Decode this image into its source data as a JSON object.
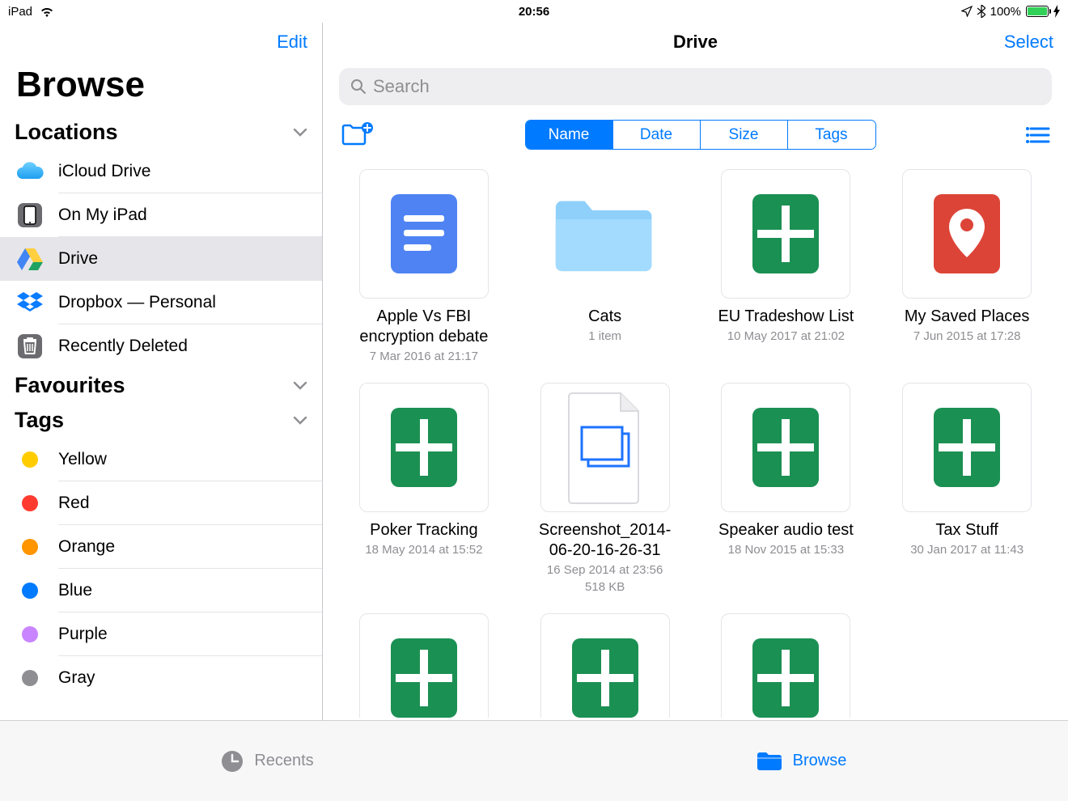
{
  "statusbar": {
    "device": "iPad",
    "time": "20:56",
    "battery_pct": "100%"
  },
  "sidebar": {
    "edit": "Edit",
    "title": "Browse",
    "sections": {
      "locations": "Locations",
      "favourites": "Favourites",
      "tags": "Tags"
    },
    "locations": [
      {
        "label": "iCloud Drive"
      },
      {
        "label": "On My iPad"
      },
      {
        "label": "Drive"
      },
      {
        "label": "Dropbox — Personal"
      },
      {
        "label": "Recently Deleted"
      }
    ],
    "tags": [
      {
        "label": "Yellow",
        "color": "#ffcc00"
      },
      {
        "label": "Red",
        "color": "#ff3b30"
      },
      {
        "label": "Orange",
        "color": "#ff9500"
      },
      {
        "label": "Blue",
        "color": "#007aff"
      },
      {
        "label": "Purple",
        "color": "#c985ff"
      },
      {
        "label": "Gray",
        "color": "#8e8e93"
      }
    ]
  },
  "main": {
    "title": "Drive",
    "select": "Select",
    "search_placeholder": "Search",
    "sort_tabs": [
      "Name",
      "Date",
      "Size",
      "Tags"
    ],
    "files": [
      {
        "name": "Apple Vs FBI encryption debate",
        "meta": "7 Mar 2016 at 21:17",
        "kind": "gdoc"
      },
      {
        "name": "Cats",
        "meta": "1 item",
        "kind": "folder"
      },
      {
        "name": "EU Tradeshow List",
        "meta": "10 May 2017 at 21:02",
        "kind": "gsheet"
      },
      {
        "name": "My Saved Places",
        "meta": "7 Jun 2015 at 17:28",
        "kind": "gmap"
      },
      {
        "name": "Poker Tracking",
        "meta": "18 May 2014 at 15:52",
        "kind": "gsheet"
      },
      {
        "name": "Screenshot_2014-06-20-16-26-31",
        "meta": "16 Sep 2014 at 23:56",
        "meta2": "518 KB",
        "kind": "image"
      },
      {
        "name": "Speaker audio test",
        "meta": "18 Nov 2015 at 15:33",
        "kind": "gsheet"
      },
      {
        "name": "Tax Stuff",
        "meta": "30 Jan 2017 at 11:43",
        "kind": "gsheet"
      },
      {
        "name": "",
        "meta": "",
        "kind": "gsheet"
      },
      {
        "name": "",
        "meta": "",
        "kind": "gsheet"
      },
      {
        "name": "",
        "meta": "",
        "kind": "gsheet"
      }
    ]
  },
  "tabbar": {
    "recents": "Recents",
    "browse": "Browse"
  }
}
